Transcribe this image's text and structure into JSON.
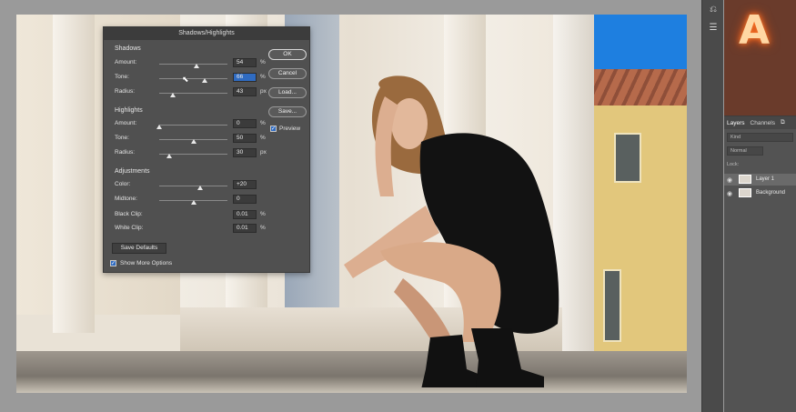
{
  "dialog": {
    "title": "Shadows/Highlights",
    "shadows": {
      "heading": "Shadows",
      "amount": {
        "label": "Amount:",
        "value": "54",
        "unit": "%",
        "level": 0.54
      },
      "tone": {
        "label": "Tone:",
        "value": "66",
        "unit": "%",
        "level": 0.66
      },
      "radius": {
        "label": "Radius:",
        "value": "43",
        "unit": "px",
        "level": 0.2
      }
    },
    "highlights": {
      "heading": "Highlights",
      "amount": {
        "label": "Amount:",
        "value": "0",
        "unit": "%",
        "level": 0.0
      },
      "tone": {
        "label": "Tone:",
        "value": "50",
        "unit": "%",
        "level": 0.5
      },
      "radius": {
        "label": "Radius:",
        "value": "30",
        "unit": "px",
        "level": 0.15
      }
    },
    "adjustments": {
      "heading": "Adjustments",
      "color": {
        "label": "Color:",
        "value": "+20",
        "level": 0.6
      },
      "midtone": {
        "label": "Midtone:",
        "value": "0",
        "level": 0.5
      },
      "black_clip": {
        "label": "Black Clip:",
        "value": "0.01",
        "unit": "%"
      },
      "white_clip": {
        "label": "White Clip:",
        "value": "0.01",
        "unit": "%"
      }
    },
    "buttons": {
      "ok": "OK",
      "cancel": "Cancel",
      "load": "Load...",
      "save": "Save..."
    },
    "preview_label": "Preview",
    "save_defaults": "Save Defaults",
    "show_more_options": "Show More Options"
  },
  "layers_panel": {
    "tabs": [
      "Layers",
      "Channels"
    ],
    "search_placeholder": "Kind",
    "blend_mode": "Normal",
    "lock_label": "Lock:",
    "layers": [
      {
        "name": "Layer 1",
        "selected": true
      },
      {
        "name": "Background",
        "selected": false
      }
    ]
  },
  "colors": {
    "dialog_bg": "#505050",
    "accent_blue": "#2f6bc1",
    "panel_bg": "#535353"
  }
}
